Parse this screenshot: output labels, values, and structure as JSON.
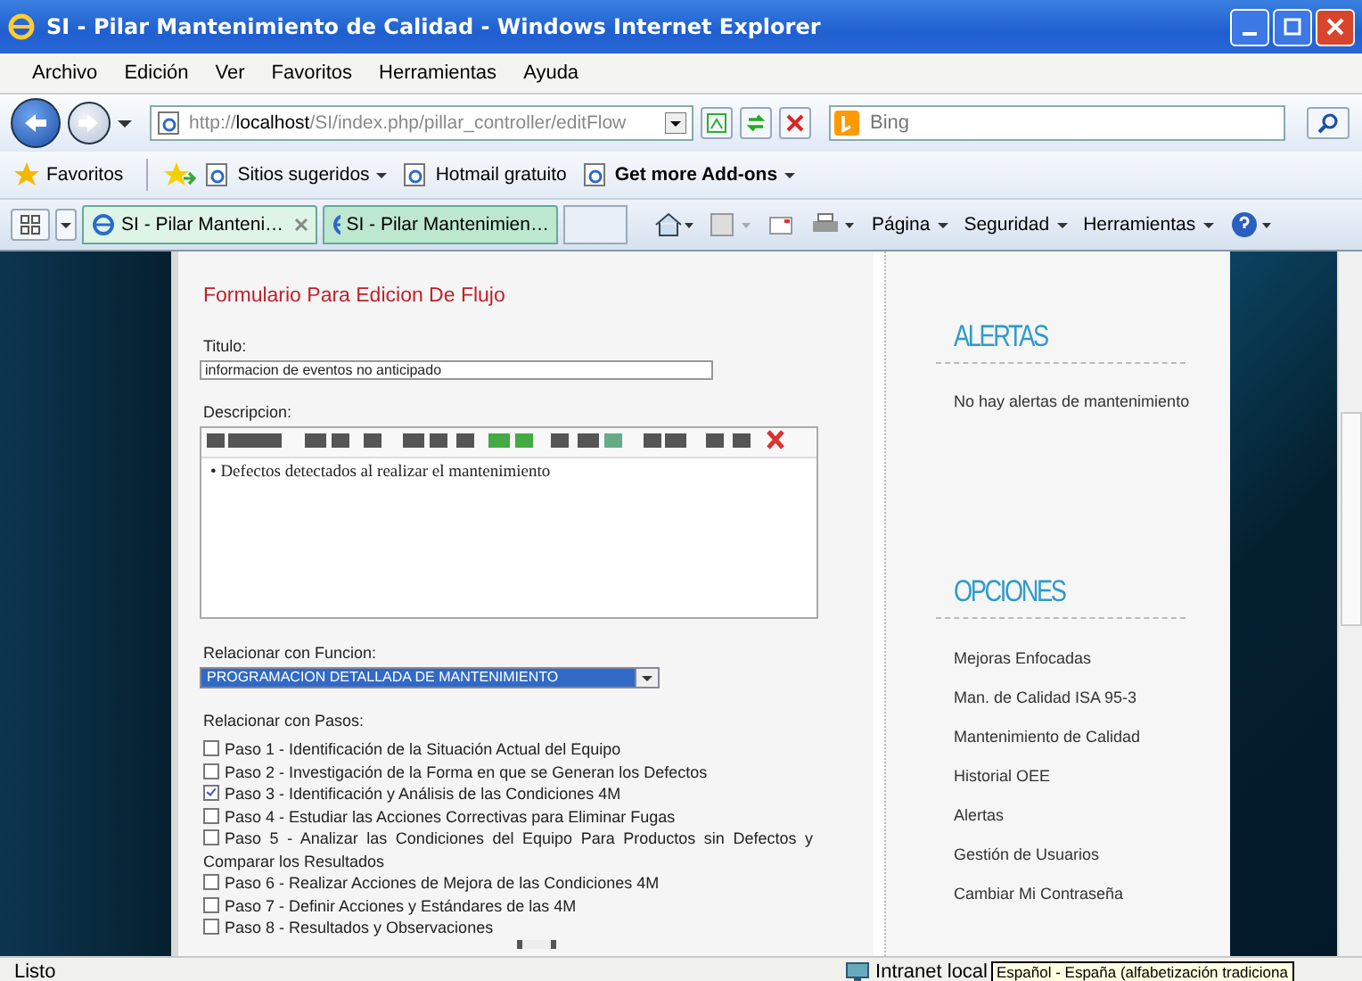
{
  "window": {
    "title": "SI - Pilar Mantenimiento de Calidad - Windows Internet Explorer"
  },
  "menu": [
    "Archivo",
    "Edición",
    "Ver",
    "Favoritos",
    "Herramientas",
    "Ayuda"
  ],
  "address": {
    "prefix": "http://",
    "host": "localhost",
    "path": "/SI/index.php/pillar_controller/editFlow"
  },
  "search": {
    "placeholder": "Bing"
  },
  "favorites_bar": {
    "label": "Favoritos",
    "links": [
      {
        "label": "Sitios sugeridos",
        "dropdown": true,
        "bold": false
      },
      {
        "label": "Hotmail gratuito",
        "dropdown": false,
        "bold": false
      },
      {
        "label": "Get more Add-ons",
        "dropdown": true,
        "bold": true
      }
    ]
  },
  "tabs": [
    {
      "label": "SI - Pilar Manteni…",
      "selected": true
    },
    {
      "label": "SI - Pilar Mantenimien…",
      "selected": false
    }
  ],
  "command_bar": [
    "Página",
    "Seguridad",
    "Herramientas"
  ],
  "form": {
    "title": "Formulario Para Edicion De Flujo",
    "titulo_label": "Titulo:",
    "titulo_value": "informacion de eventos no anticipado",
    "descripcion_label": "Descripcion:",
    "descripcion_text": "• Defectos detectados al realizar el mantenimiento",
    "funcion_label": "Relacionar con Funcion:",
    "funcion_value": "PROGRAMACION DETALLADA DE MANTENIMIENTO",
    "pasos_label": "Relacionar con Pasos:",
    "pasos": [
      {
        "label": "Paso 1 - Identificación de la Situación Actual del Equipo",
        "checked": false
      },
      {
        "label": "Paso 2 - Investigación de la Forma en que se Generan los Defectos",
        "checked": false
      },
      {
        "label": "Paso 3 - Identificación y Análisis de las Condiciones 4M",
        "checked": true
      },
      {
        "label": "Paso 4 - Estudiar las Acciones Correctivas para Eliminar Fugas",
        "checked": false
      },
      {
        "label": "Paso 5 - Analizar las Condiciones del Equipo Para Productos sin Defectos y Comparar los Resultados",
        "checked": false
      },
      {
        "label": "Paso 6 - Realizar Acciones de Mejora de las Condiciones 4M",
        "checked": false
      },
      {
        "label": "Paso 7 - Definir Acciones y Estándares de las 4M",
        "checked": false
      },
      {
        "label": "Paso 8 - Resultados y Observaciones",
        "checked": false
      }
    ]
  },
  "sidebar": {
    "alerts": {
      "heading": "ALERTAS",
      "text": "No hay alertas de mantenimiento"
    },
    "options": {
      "heading": "OPCIONES",
      "links": [
        "Mejoras Enfocadas",
        "Man. de Calidad ISA 95-3",
        "Mantenimiento de Calidad",
        "Historial OEE",
        "Alertas",
        "Gestión de Usuarios",
        "Cambiar Mi Contraseña"
      ]
    }
  },
  "status_bar": {
    "text": "Listo",
    "zone": "Intranet local",
    "tooltip": "Español - España (alfabetización tradiciona"
  }
}
